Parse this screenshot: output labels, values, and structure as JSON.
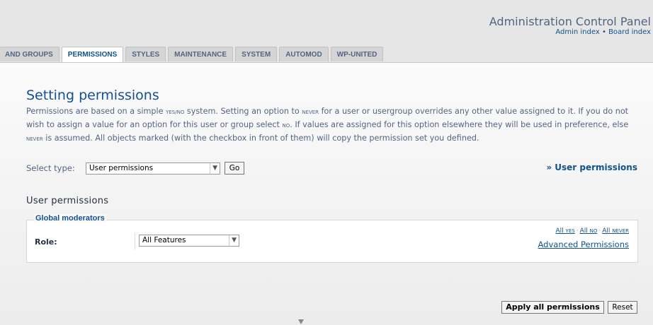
{
  "header": {
    "title": "Administration Control Panel",
    "links": [
      {
        "label": "Admin index"
      },
      {
        "label": "Board index"
      }
    ],
    "separator": "•"
  },
  "tabs": [
    {
      "label": "AND GROUPS",
      "active": false
    },
    {
      "label": "PERMISSIONS",
      "active": true
    },
    {
      "label": "STYLES",
      "active": false
    },
    {
      "label": "MAINTENANCE",
      "active": false
    },
    {
      "label": "SYSTEM",
      "active": false
    },
    {
      "label": "AUTOMOD",
      "active": false
    },
    {
      "label": "WP-UNITED",
      "active": false
    }
  ],
  "main": {
    "title": "Setting permissions",
    "intro": {
      "p1": "Permissions are based on a simple ",
      "yesno": "YES/NO",
      "p2": " system. Setting an option to ",
      "never1": "NEVER",
      "p3": " for a user or usergroup overrides any other value assigned to it. If you do not wish to assign a value for an option for this user or group select ",
      "no": "NO",
      "p4": ". If values are assigned for this option elsewhere they will be used in preference, else ",
      "never2": "NEVER",
      "p5": " is assumed. All objects marked (with the checkbox in front of them) will copy the permission set you defined."
    },
    "select_type": {
      "label": "Select type:",
      "value": "User permissions",
      "arrow": "▼",
      "go_label": "Go"
    },
    "right_link": "» User permissions",
    "section_title": "User permissions",
    "fieldset": {
      "legend": "Global moderators",
      "role_label": "Role:",
      "role_value": "All Features",
      "arrow": "▼",
      "all_yes": "All YES",
      "all_no": "All NO",
      "all_never": "All NEVER",
      "dot": "·",
      "advanced": "Advanced Permissions"
    },
    "buttons": {
      "apply": "Apply all permissions",
      "reset": "Reset"
    }
  },
  "colors": {
    "link": "#105289",
    "heading": "#115098",
    "text": "#536482"
  }
}
